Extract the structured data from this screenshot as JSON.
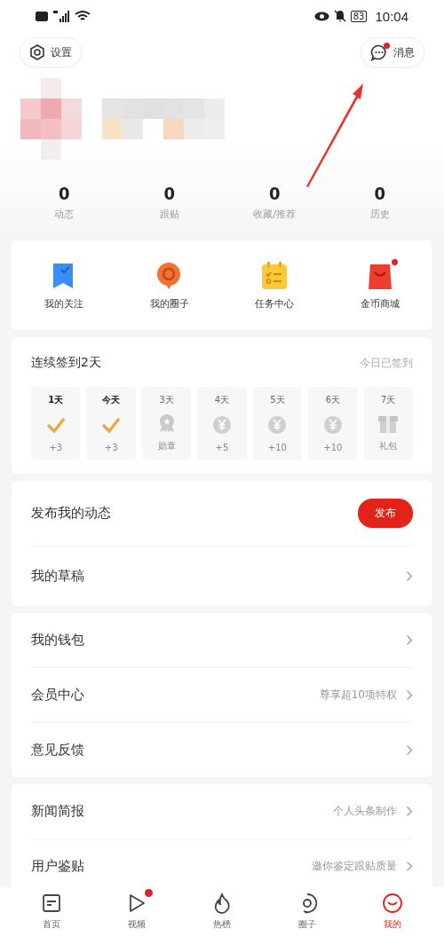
{
  "status_bar": {
    "battery": "83",
    "time": "10:04"
  },
  "header": {
    "settings_button": {
      "label": "设置"
    },
    "messages_button": {
      "label": "消息",
      "badge": true
    }
  },
  "stats": [
    {
      "value": "0",
      "label": "动态"
    },
    {
      "value": "0",
      "label": "跟贴"
    },
    {
      "value": "0",
      "label": "收藏/推荐"
    },
    {
      "value": "0",
      "label": "历史"
    }
  ],
  "shortcuts": [
    {
      "label": "我的关注",
      "kind": "bookmark",
      "badge": false
    },
    {
      "label": "我的圈子",
      "kind": "bubble",
      "badge": false
    },
    {
      "label": "任务中心",
      "kind": "tasks",
      "badge": false
    },
    {
      "label": "金币商城",
      "kind": "bag",
      "badge": true
    }
  ],
  "checkin": {
    "title": "连续签到2天",
    "status": "今日已签到",
    "days": [
      {
        "label": "1天",
        "reward": "+3",
        "done": true
      },
      {
        "label": "今天",
        "reward": "+3",
        "done": true
      },
      {
        "label": "3天",
        "reward": "勋章",
        "done": false,
        "kind": "medal"
      },
      {
        "label": "4天",
        "reward": "+5",
        "done": false,
        "kind": "coin"
      },
      {
        "label": "5天",
        "reward": "+10",
        "done": false,
        "kind": "coin"
      },
      {
        "label": "6天",
        "reward": "+10",
        "done": false,
        "kind": "coin"
      },
      {
        "label": "7天",
        "reward": "礼包",
        "done": false,
        "kind": "gift"
      }
    ]
  },
  "sections": [
    {
      "rows": [
        {
          "kind": "button",
          "label": "发布我的动态",
          "button_label": "发布"
        },
        {
          "kind": "link",
          "label": "我的草稿"
        }
      ]
    },
    {
      "rows": [
        {
          "kind": "link",
          "label": "我的钱包"
        },
        {
          "kind": "link",
          "label": "会员中心",
          "hint": "尊享超10项特权"
        },
        {
          "kind": "link",
          "label": "意见反馈"
        }
      ]
    },
    {
      "rows": [
        {
          "kind": "link",
          "label": "新闻简报",
          "hint": "个人头条制作"
        },
        {
          "kind": "link",
          "label": "用户鉴贴",
          "hint": "邀你鉴定跟贴质量"
        }
      ]
    }
  ],
  "tab_bar": [
    {
      "label": "首页",
      "kind": "home",
      "selected": false,
      "badge": false
    },
    {
      "label": "视频",
      "kind": "video",
      "selected": false,
      "badge": true
    },
    {
      "label": "热榜",
      "kind": "flame",
      "selected": false,
      "badge": false
    },
    {
      "label": "圈子",
      "kind": "circle",
      "selected": false,
      "badge": false
    },
    {
      "label": "我的",
      "kind": "me",
      "selected": true,
      "badge": false
    }
  ]
}
